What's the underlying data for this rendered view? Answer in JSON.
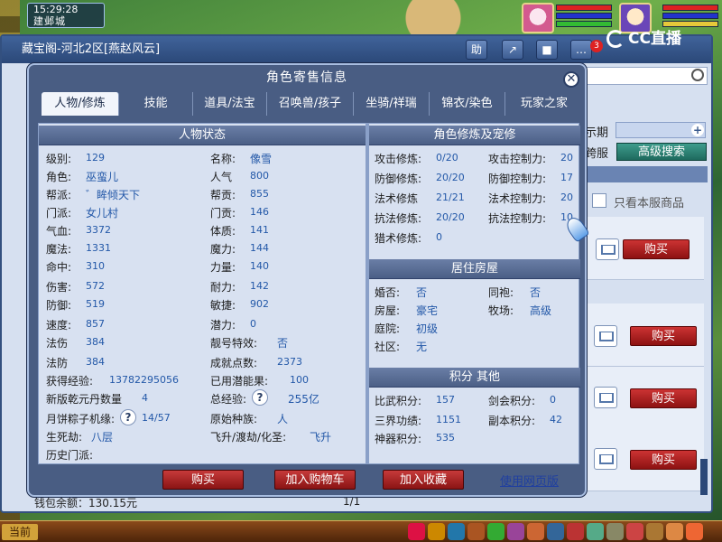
{
  "hud": {
    "time": "15:29:28",
    "city": "建邺城"
  },
  "stream_logo": "CC直播",
  "base_window": {
    "title": "藏宝阁-河北2区[燕赵风云]",
    "toolbar": {
      "help_label": "助",
      "notification_count": "3"
    },
    "right_panel": {
      "label_period": "示期",
      "label_cross_server": "跨服",
      "adv_search": "高级搜索",
      "only_this_server": "只看本服商品",
      "buy_label": "购买"
    },
    "footer": {
      "balance": "钱包余额：130.15元",
      "page": "1/1"
    }
  },
  "dialog": {
    "title": "角色寄售信息",
    "tabs": [
      "人物/修炼",
      "技能",
      "道具/法宝",
      "召唤兽/孩子",
      "坐骑/祥瑞",
      "锦衣/染色",
      "玩家之家"
    ],
    "status": {
      "header": "人物状态",
      "level_label": "级别:",
      "level": "129",
      "name_label": "名称:",
      "name": "像雪",
      "role_label": "角色:",
      "role": "巫蛮儿",
      "popularity_label": "人气",
      "popularity": "800",
      "guild_label": "帮派:",
      "guild": "゛眸倾天下",
      "guild_contrib_label": "帮贡:",
      "guild_contrib": "855",
      "school_label": "门派:",
      "school": "女儿村",
      "school_contrib_label": "门贡:",
      "school_contrib": "146",
      "hp_label": "气血:",
      "hp": "3372",
      "physique_label": "体质:",
      "physique": "141",
      "mp_label": "魔法:",
      "mp": "1331",
      "magic_label": "魔力:",
      "magic": "144",
      "hit_label": "命中:",
      "hit": "310",
      "strength_label": "力量:",
      "strength": "140",
      "damage_label": "伤害:",
      "damage": "572",
      "endurance_label": "耐力:",
      "endurance": "142",
      "defense_label": "防御:",
      "defense": "519",
      "agility_label": "敏捷:",
      "agility": "902",
      "speed_label": "速度:",
      "speed": "857",
      "potential_label": "潜力:",
      "potential": "0",
      "mdmg_label": "法伤",
      "mdmg": "384",
      "special_label": "靓号特效:",
      "special": "否",
      "mdef_label": "法防",
      "mdef": "384",
      "achievement_label": "成就点数:",
      "achievement": "2373",
      "exp_label": "获得经验:",
      "exp": "13782295056",
      "used_potential_label": "已用潜能果:",
      "used_potential": "100",
      "qianyuan_label": "新版乾元丹数量",
      "qianyuan": "4",
      "total_exp_label": "总经验:",
      "total_exp": "255亿",
      "mooncake_label": "月饼粽子机缘:",
      "mooncake": "14/57",
      "race_label": "原始种族:",
      "race": "人",
      "life_death_label": "生死劫:",
      "life_death": "八层",
      "ascend_label": "飞升/渡劫/化圣:",
      "ascend": "飞升",
      "history_school_label": "历史门派:"
    },
    "cultivation": {
      "header": "角色修炼及宠修",
      "attack_label": "攻击修炼:",
      "attack": "0/20",
      "attack_ctrl_label": "攻击控制力:",
      "attack_ctrl": "20",
      "defense_label": "防御修炼:",
      "defense": "20/20",
      "defense_ctrl_label": "防御控制力:",
      "defense_ctrl": "17",
      "magic_label": "法术修炼",
      "magic": "21/21",
      "magic_ctrl_label": "法术控制力:",
      "magic_ctrl": "20",
      "resist_label": "抗法修炼:",
      "resist": "20/20",
      "resist_ctrl_label": "抗法控制力:",
      "resist_ctrl": "10",
      "hunt_label": "猎术修炼:",
      "hunt": "0"
    },
    "house": {
      "header": "居住房屋",
      "married_label": "婚否:",
      "married": "否",
      "sworn_label": "同袍:",
      "sworn": "否",
      "house_label": "房屋:",
      "house": "豪宅",
      "ranch_label": "牧场:",
      "ranch": "高级",
      "courtyard_label": "庭院:",
      "courtyard": "初级",
      "community_label": "社区:",
      "community": "无"
    },
    "points": {
      "header": "积分 其他",
      "pk_label": "比武积分:",
      "pk": "157",
      "jianhui_label": "剑会积分:",
      "jianhui": "0",
      "sanjie_label": "三界功绩:",
      "sanjie": "1151",
      "dungeon_label": "副本积分:",
      "dungeon": "42",
      "shenqi_label": "神器积分:",
      "shenqi": "535"
    },
    "footer": {
      "buy": "购买",
      "add_cart": "加入购物车",
      "add_fav": "加入收藏",
      "web_version": "使用网页版"
    }
  },
  "bottom_bar": {
    "current_label": "当前"
  },
  "colors": {
    "dialog_bg": "#495d83",
    "content_bg": "#d8e1f1",
    "value_blue": "#2358a8",
    "buy_red": "#b82222"
  }
}
